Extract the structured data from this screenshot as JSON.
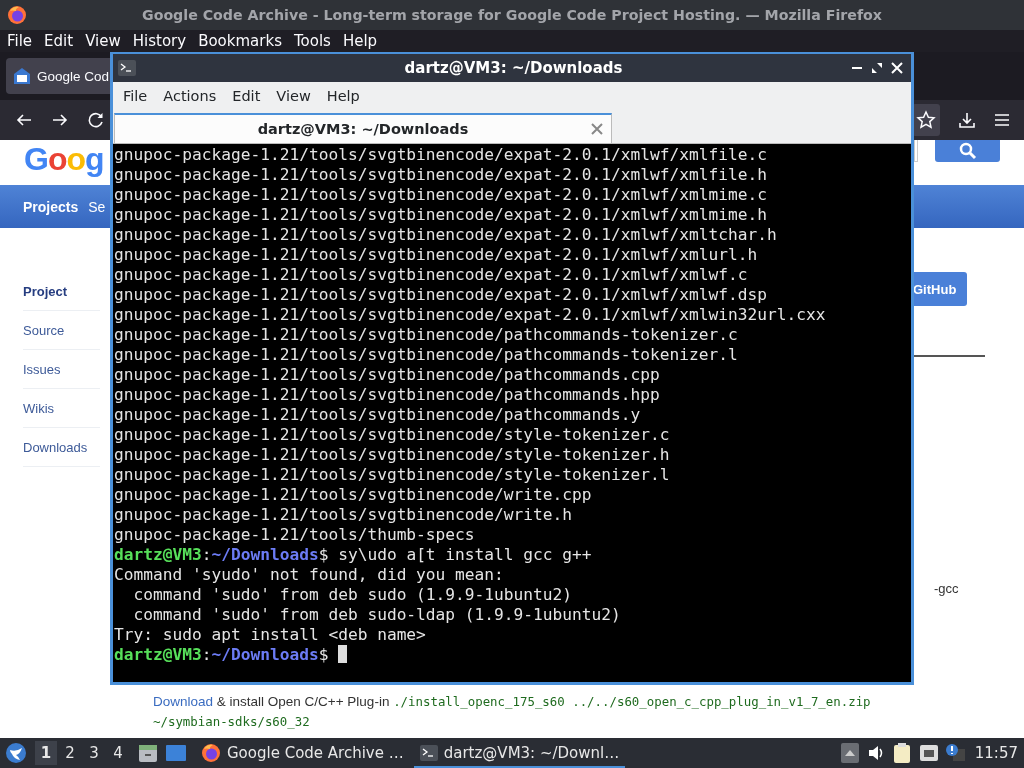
{
  "firefox": {
    "title": "Google Code Archive - Long-term storage for Google Code Project Hosting. — Mozilla Firefox",
    "menu": [
      "File",
      "Edit",
      "View",
      "History",
      "Bookmarks",
      "Tools",
      "Help"
    ],
    "tabs": [
      {
        "label": "Google Cod",
        "selected": true
      }
    ],
    "page": {
      "logo": "Goog",
      "nav": [
        {
          "label": "Projects",
          "selected": true
        },
        {
          "label": "Se",
          "selected": false
        }
      ],
      "sidebar": [
        {
          "label": "Project",
          "selected": true
        },
        {
          "label": "Source",
          "selected": false
        },
        {
          "label": "Issues",
          "selected": false
        },
        {
          "label": "Wikis",
          "selected": false
        },
        {
          "label": "Downloads",
          "selected": false
        }
      ],
      "github_button": "GitHub",
      "fragment": "-gcc",
      "instructions": {
        "link": "Download",
        "text": "& install Open C/C++ Plug-in",
        "code_lines": [
          "./install_openc_175_s60 ../../s60_open_c_cpp_plug_in_v1_7_en.zip",
          "~/symbian-sdks/s60_32"
        ]
      }
    }
  },
  "terminal": {
    "title": "dartz@VM3: ~/Downloads",
    "menu": [
      "File",
      "Actions",
      "Edit",
      "View",
      "Help"
    ],
    "tabs": [
      {
        "label": "dartz@VM3: ~/Downloads",
        "selected": true
      }
    ],
    "lines": [
      {
        "kind": "output",
        "text": "gnupoc-package-1.21/tools/svgtbinencode/expat-2.0.1/xmlwf/xmlfile.c"
      },
      {
        "kind": "output",
        "text": "gnupoc-package-1.21/tools/svgtbinencode/expat-2.0.1/xmlwf/xmlfile.h"
      },
      {
        "kind": "output",
        "text": "gnupoc-package-1.21/tools/svgtbinencode/expat-2.0.1/xmlwf/xmlmime.c"
      },
      {
        "kind": "output",
        "text": "gnupoc-package-1.21/tools/svgtbinencode/expat-2.0.1/xmlwf/xmlmime.h"
      },
      {
        "kind": "output",
        "text": "gnupoc-package-1.21/tools/svgtbinencode/expat-2.0.1/xmlwf/xmltchar.h"
      },
      {
        "kind": "output",
        "text": "gnupoc-package-1.21/tools/svgtbinencode/expat-2.0.1/xmlwf/xmlurl.h"
      },
      {
        "kind": "output",
        "text": "gnupoc-package-1.21/tools/svgtbinencode/expat-2.0.1/xmlwf/xmlwf.c"
      },
      {
        "kind": "output",
        "text": "gnupoc-package-1.21/tools/svgtbinencode/expat-2.0.1/xmlwf/xmlwf.dsp"
      },
      {
        "kind": "output",
        "text": "gnupoc-package-1.21/tools/svgtbinencode/expat-2.0.1/xmlwf/xmlwin32url.cxx"
      },
      {
        "kind": "output",
        "text": "gnupoc-package-1.21/tools/svgtbinencode/pathcommands-tokenizer.c"
      },
      {
        "kind": "output",
        "text": "gnupoc-package-1.21/tools/svgtbinencode/pathcommands-tokenizer.l"
      },
      {
        "kind": "output",
        "text": "gnupoc-package-1.21/tools/svgtbinencode/pathcommands.cpp"
      },
      {
        "kind": "output",
        "text": "gnupoc-package-1.21/tools/svgtbinencode/pathcommands.hpp"
      },
      {
        "kind": "output",
        "text": "gnupoc-package-1.21/tools/svgtbinencode/pathcommands.y"
      },
      {
        "kind": "output",
        "text": "gnupoc-package-1.21/tools/svgtbinencode/style-tokenizer.c"
      },
      {
        "kind": "output",
        "text": "gnupoc-package-1.21/tools/svgtbinencode/style-tokenizer.h"
      },
      {
        "kind": "output",
        "text": "gnupoc-package-1.21/tools/svgtbinencode/style-tokenizer.l"
      },
      {
        "kind": "output",
        "text": "gnupoc-package-1.21/tools/svgtbinencode/write.cpp"
      },
      {
        "kind": "output",
        "text": "gnupoc-package-1.21/tools/svgtbinencode/write.h"
      },
      {
        "kind": "output",
        "text": "gnupoc-package-1.21/tools/thumb-specs"
      },
      {
        "kind": "prompt",
        "user_host": "dartz@VM3",
        "separator": ":",
        "path": "~/Downloads",
        "symbol": "$",
        "command": "sy\\udo a[t install gcc g++",
        "cursor": false
      },
      {
        "kind": "output",
        "text": "Command 'syudo' not found, did you mean:"
      },
      {
        "kind": "output",
        "text": "  command 'sudo' from deb sudo (1.9.9-1ubuntu2)"
      },
      {
        "kind": "output",
        "text": "  command 'sudo' from deb sudo-ldap (1.9.9-1ubuntu2)"
      },
      {
        "kind": "output",
        "text": "Try: sudo apt install <deb name>"
      },
      {
        "kind": "prompt",
        "user_host": "dartz@VM3",
        "separator": ":",
        "path": "~/Downloads",
        "symbol": "$",
        "cursor": true
      }
    ]
  },
  "taskbar": {
    "workspaces": [
      {
        "label": "1",
        "selected": true
      },
      {
        "label": "2",
        "selected": false
      },
      {
        "label": "3",
        "selected": false
      },
      {
        "label": "4",
        "selected": false
      }
    ],
    "tasks": [
      {
        "kind": "browser",
        "label": "Google Code Archive …",
        "selected": false
      },
      {
        "kind": "terminal",
        "label": "dartz@VM3: ~/Downl…",
        "selected": true
      }
    ],
    "clock": "11:57"
  }
}
